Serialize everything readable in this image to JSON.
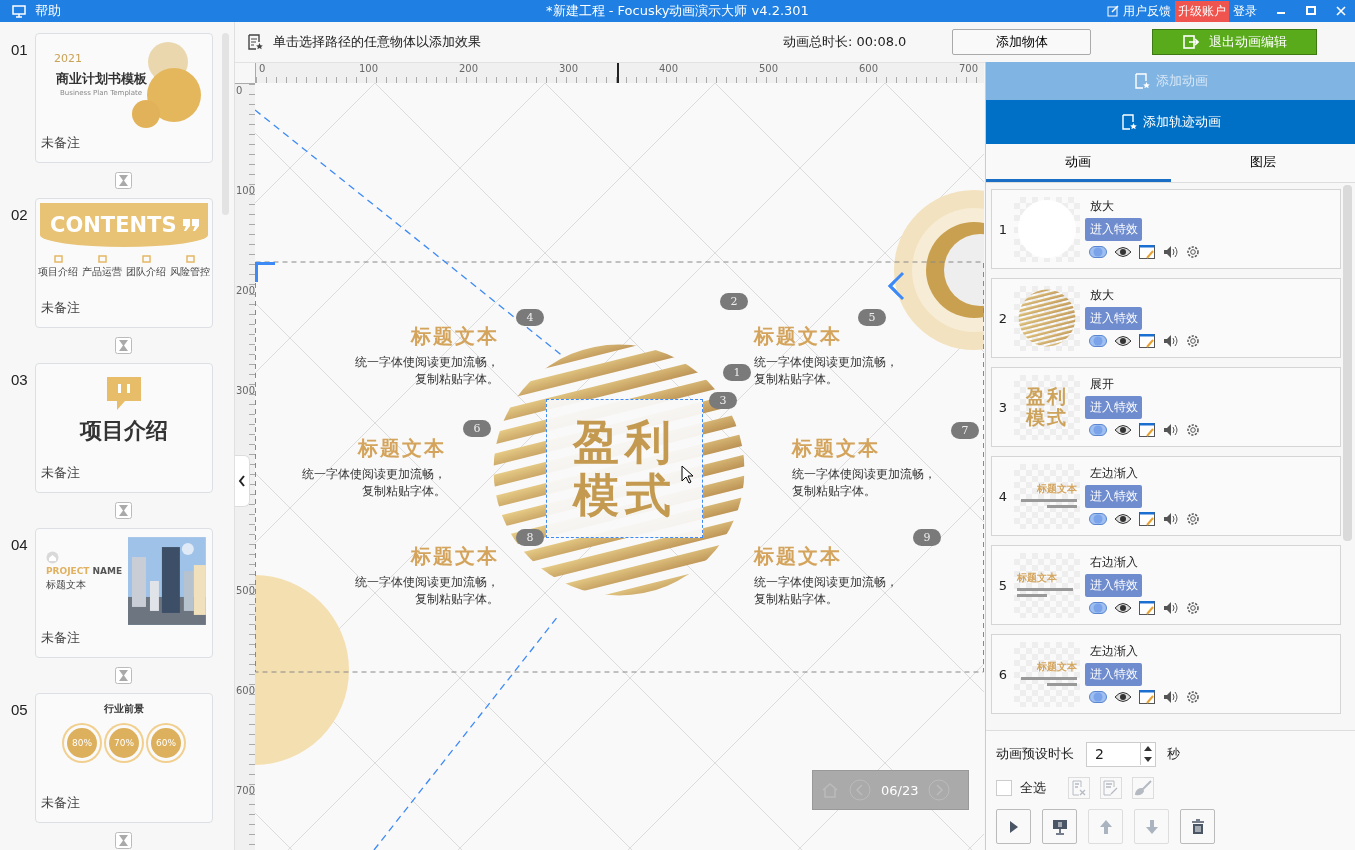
{
  "title_bar": {
    "menu": "帮助",
    "title": "*新建工程 - Focusky动画演示大师  v4.2.301",
    "feedback": "用户反馈",
    "upgrade": "升级账户",
    "login": "登录"
  },
  "slides": [
    {
      "number": "01",
      "kind": "cover",
      "texts": [
        "2021",
        "商业计划书模板",
        "Business Plan Template"
      ],
      "note": "未备注"
    },
    {
      "number": "02",
      "kind": "contents",
      "texts": [
        "CONTENTS",
        "项目介绍",
        "产品运营",
        "团队介绍",
        "风险管控"
      ],
      "note": "未备注"
    },
    {
      "number": "03",
      "kind": "section",
      "texts": [
        "项目介绍"
      ],
      "note": "未备注"
    },
    {
      "number": "04",
      "kind": "project",
      "texts": [
        "PROJECT",
        "NAME",
        "标题文本"
      ],
      "note": "未备注"
    },
    {
      "number": "05",
      "kind": "prospects",
      "texts": [
        "行业前景",
        "80%",
        "70%",
        "60%"
      ],
      "note": "未备注"
    }
  ],
  "toolbar": {
    "hint": "单击选择路径的任意物体以添加效果",
    "duration": "动画总时长: 00:08.0",
    "add_object": "添加物体",
    "exit": "退出动画编辑"
  },
  "ruler": {
    "x_ticks": [
      "0",
      "100",
      "200",
      "300",
      "400",
      "500",
      "600",
      "700"
    ],
    "y_ticks": [
      "0",
      "100",
      "200",
      "300",
      "500",
      "600",
      "700"
    ]
  },
  "canvas": {
    "center_title": [
      "盈利",
      "模式"
    ],
    "blocks": [
      {
        "title": "标题文本",
        "body": [
          "统一字体使阅读更加流畅，",
          "复制粘贴字体。"
        ]
      },
      {
        "title": "标题文本",
        "body": [
          "统一字体使阅读更加流畅，",
          "复制粘贴字体。"
        ]
      },
      {
        "title": "标题文本",
        "body": [
          "统一字体使阅读更加流畅，",
          "复制粘贴字体。"
        ]
      },
      {
        "title": "标题文本",
        "body": [
          "统一字体使阅读更加流畅，",
          "复制粘贴字体。"
        ]
      },
      {
        "title": "标题文本",
        "body": [
          "统一字体使阅读更加流畅，",
          "复制粘贴字体。"
        ]
      },
      {
        "title": "标题文本",
        "body": [
          "统一字体使阅读更加流畅，",
          "复制粘贴字体。"
        ]
      }
    ],
    "markers": [
      "4",
      "2",
      "5",
      "1",
      "3",
      "6",
      "7",
      "8",
      "9"
    ]
  },
  "navigator": {
    "page": "06/23"
  },
  "panel": {
    "add_animation": {
      "label": "添加动画",
      "disabled": true
    },
    "add_path": {
      "label": "添加轨迹动画",
      "disabled": false
    },
    "tabs": [
      {
        "label": "动画",
        "selected": true
      },
      {
        "label": "图层",
        "selected": false
      }
    ],
    "animations": [
      {
        "number": "1",
        "name": "放大",
        "effect": "进入特效",
        "thumb": {
          "kind": "blank"
        }
      },
      {
        "number": "2",
        "name": "放大",
        "effect": "进入特效",
        "thumb": {
          "kind": "sphere"
        }
      },
      {
        "number": "3",
        "name": "展开",
        "effect": "进入特效",
        "thumb": {
          "kind": "text",
          "lines": [
            "盈利",
            "模式"
          ]
        }
      },
      {
        "number": "4",
        "name": "左边渐入",
        "effect": "进入特效",
        "thumb": {
          "kind": "block-right",
          "title": "标题文本"
        }
      },
      {
        "number": "5",
        "name": "右边渐入",
        "effect": "进入特效",
        "thumb": {
          "kind": "block-left",
          "title": "标题文本"
        }
      },
      {
        "number": "6",
        "name": "左边渐入",
        "effect": "进入特效",
        "thumb": {
          "kind": "block-right",
          "title": "标题文本"
        }
      }
    ],
    "preset_label": "动画预设时长",
    "preset_value": "2",
    "preset_unit": "秒",
    "select_all": {
      "label": "全选",
      "checked": false
    },
    "tools": [
      {
        "kind": "remove",
        "disabled": true
      },
      {
        "kind": "edit",
        "disabled": true
      },
      {
        "kind": "brush",
        "disabled": true
      }
    ],
    "actions": [
      {
        "kind": "play",
        "disabled": false
      },
      {
        "kind": "present",
        "disabled": false
      },
      {
        "kind": "up",
        "disabled": true
      },
      {
        "kind": "down",
        "disabled": true
      },
      {
        "kind": "delete",
        "disabled": false
      }
    ]
  }
}
